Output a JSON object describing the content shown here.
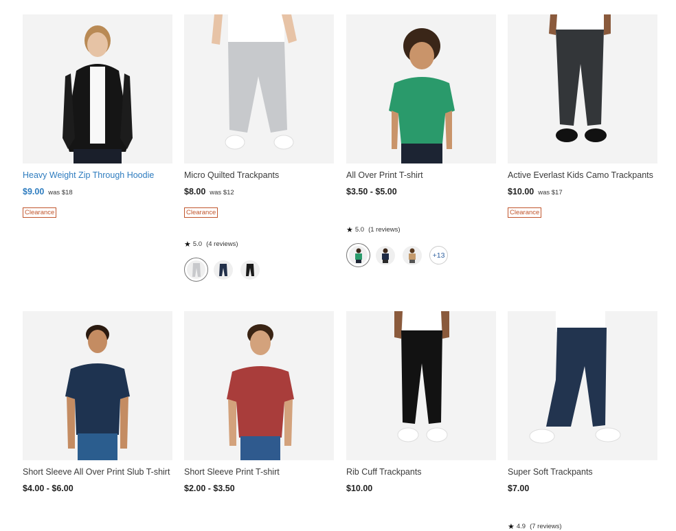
{
  "products": [
    {
      "title": "Heavy Weight Zip Through Hoodie",
      "price": "$9.00",
      "was": "was $18",
      "badge": "Clearance"
    },
    {
      "title": "Micro Quilted Trackpants",
      "price": "$8.00",
      "was": "was $12",
      "badge": "Clearance",
      "rating": "5.0",
      "reviews": "(4 reviews)"
    },
    {
      "title": "All Over Print T-shirt",
      "price": "$3.50 - $5.00",
      "rating": "5.0",
      "reviews": "(1 reviews)",
      "more_colours": "+13"
    },
    {
      "title": "Active Everlast Kids Camo Trackpants",
      "price": "$10.00",
      "was": "was $17",
      "badge": "Clearance"
    },
    {
      "title": "Short Sleeve All Over Print Slub T-shirt",
      "price": "$4.00 - $6.00"
    },
    {
      "title": "Short Sleeve Print T-shirt",
      "price": "$2.00 - $3.50"
    },
    {
      "title": "Rib Cuff Trackpants",
      "price": "$10.00"
    },
    {
      "title": "Super Soft Trackpants",
      "price": "$7.00",
      "rating": "4.9",
      "reviews": "(7 reviews)"
    }
  ],
  "colors": {
    "link": "#2e7cbf",
    "badge": "#c0542b",
    "image_bg": "#f2f2f2"
  }
}
